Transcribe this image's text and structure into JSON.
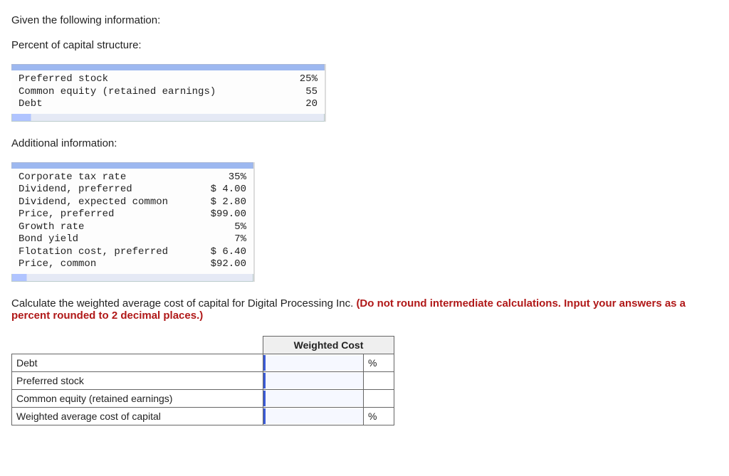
{
  "intro": "Given the following information:",
  "section1_title": "Percent of capital structure:",
  "capStruct": [
    {
      "label": "Preferred stock",
      "value": "25%"
    },
    {
      "label": "Common equity (retained earnings)",
      "value": "55"
    },
    {
      "label": "Debt",
      "value": "20"
    }
  ],
  "section2_title": "Additional information:",
  "addlInfo": [
    {
      "label": "Corporate tax rate",
      "value": "35%"
    },
    {
      "label": "Dividend, preferred",
      "value": "$ 4.00"
    },
    {
      "label": "Dividend, expected common",
      "value": "$ 2.80"
    },
    {
      "label": "Price, preferred",
      "value": "$99.00"
    },
    {
      "label": "Growth rate",
      "value": "5%"
    },
    {
      "label": "Bond yield",
      "value": "7%"
    },
    {
      "label": "Flotation cost, preferred",
      "value": "$ 6.40"
    },
    {
      "label": "Price, common",
      "value": "$92.00"
    }
  ],
  "question_plain": "Calculate the weighted average cost of capital for Digital Processing Inc. ",
  "question_bold": "(Do not round intermediate calculations. Input your answers as a percent rounded to 2 decimal places.)",
  "answerHeader": "Weighted Cost",
  "answerRows": [
    {
      "label": "Debt",
      "unit": "%",
      "input": true
    },
    {
      "label": "Preferred stock",
      "unit": "",
      "input": true
    },
    {
      "label": "Common equity (retained earnings)",
      "unit": "",
      "input": true
    },
    {
      "label": "Weighted average cost of capital",
      "unit": "%",
      "input": true
    }
  ]
}
